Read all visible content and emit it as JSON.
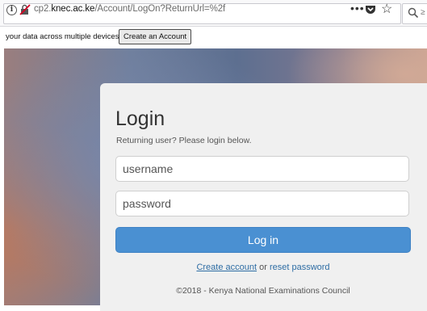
{
  "browser": {
    "url_prefix": "cp2.",
    "url_domain": "knec.ac.ke",
    "url_path": "/Account/LogOn?ReturnUrl=%2f",
    "menu_dots": "•••",
    "search_hint": "≥"
  },
  "notification": {
    "text": "your data across multiple devices",
    "button_label": "Create an Account"
  },
  "login": {
    "title": "Login",
    "subtitle": "Returning user? Please login below.",
    "username_placeholder": "username",
    "password_placeholder": "password",
    "submit_label": "Log in",
    "create_account_label": "Create account",
    "or_text": " or ",
    "reset_password_label": "reset password",
    "footer": "©2018 - Kenya National Examinations Council"
  },
  "colors": {
    "primary_button": "#4a90d2",
    "link": "#2e6da4",
    "card_background": "#f0f0f0"
  }
}
